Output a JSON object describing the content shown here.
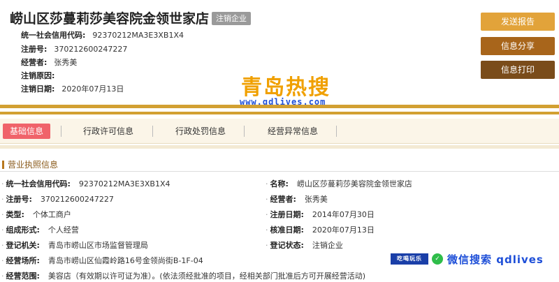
{
  "header": {
    "company_name": "崂山区莎蔓莉莎美容院金领世家店",
    "status_tag": "注销企业",
    "rows": [
      {
        "label": "统一社会信用代码:",
        "value": "92370212MA3E3XB1X4"
      },
      {
        "label": "注册号:",
        "value": "370212600247227"
      },
      {
        "label": "经营者:",
        "value": "张秀美"
      },
      {
        "label": "注销原因:",
        "value": ""
      },
      {
        "label": "注销日期:",
        "value": "2020年07月13日"
      }
    ]
  },
  "actions": {
    "report": "发送报告",
    "share": "信息分享",
    "print": "信息打印"
  },
  "watermark": {
    "brand": "青岛热搜",
    "url": "www.qdlives.com",
    "badge": "吃喝玩乐",
    "wechat_text": "微信搜索 qdlives"
  },
  "tabs": [
    {
      "label": "基础信息",
      "active": true
    },
    {
      "label": "行政许可信息",
      "active": false
    },
    {
      "label": "行政处罚信息",
      "active": false
    },
    {
      "label": "经营异常信息",
      "active": false
    }
  ],
  "section": {
    "title": "营业执照信息"
  },
  "details_left": [
    {
      "label": "统一社会信用代码:",
      "value": "92370212MA3E3XB1X4"
    },
    {
      "label": "注册号:",
      "value": "370212600247227"
    },
    {
      "label": "类型:",
      "value": "个体工商户"
    },
    {
      "label": "组成形式:",
      "value": "个人经营"
    },
    {
      "label": "登记机关:",
      "value": "青岛市崂山区市场监督管理局"
    },
    {
      "label": "经营场所:",
      "value": "青岛市崂山区仙霞岭路16号金领尚街B-1F-04"
    },
    {
      "label": "经营范围:",
      "value": "美容店（有效期以许可证为准）。(依法须经批准的项目，经相关部门批准后方可开展经营活动)"
    }
  ],
  "details_right": [
    {
      "label": "名称:",
      "value": "崂山区莎蔓莉莎美容院金领世家店"
    },
    {
      "label": "经营者:",
      "value": "张秀美"
    },
    {
      "label": "注册日期:",
      "value": "2014年07月30日"
    },
    {
      "label": "核准日期:",
      "value": "2020年07月13日"
    },
    {
      "label": "登记状态:",
      "value": "注销企业"
    }
  ],
  "colors": {
    "gold": "#d2a032",
    "active_tab": "#f0636a",
    "btn_report": "#e2a33a",
    "btn_share": "#a8651b",
    "btn_print": "#7a4c1a"
  }
}
